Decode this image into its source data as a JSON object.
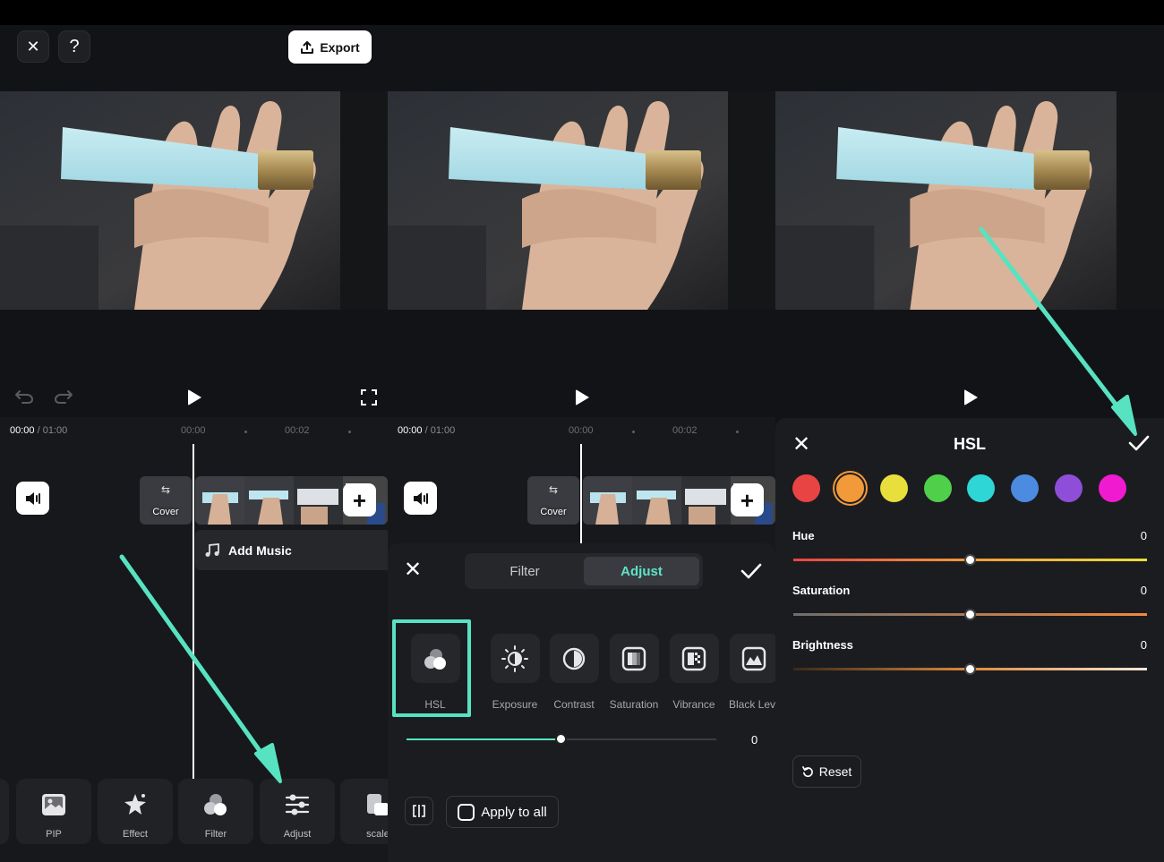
{
  "editor": {
    "export_label": "Export",
    "time_current": "00:00",
    "time_total": " / 01:00",
    "ruler_0": "00:00",
    "ruler_2": "00:02",
    "cover_label": "Cover",
    "add_music_label": "Add Music",
    "tools": [
      {
        "label": "PIP",
        "icon": "pip-icon"
      },
      {
        "label": "Effect",
        "icon": "effect-icon"
      },
      {
        "label": "Filter",
        "icon": "filter-icon"
      },
      {
        "label": "Adjust",
        "icon": "adjust-icon"
      },
      {
        "label": "scale",
        "icon": "scale-icon"
      }
    ]
  },
  "adjust_panel": {
    "tab_filter": "Filter",
    "tab_adjust": "Adjust",
    "tools": [
      {
        "label": "HSL",
        "icon": "hsl-icon"
      },
      {
        "label": "Exposure",
        "icon": "exposure-icon"
      },
      {
        "label": "Contrast",
        "icon": "contrast-icon"
      },
      {
        "label": "Saturation",
        "icon": "saturation-icon"
      },
      {
        "label": "Vibrance",
        "icon": "vibrance-icon"
      },
      {
        "label": "Black Level",
        "icon": "black-level-icon"
      }
    ],
    "slider_value": "0",
    "slider_fraction": 0.5,
    "apply_all_label": "Apply to all",
    "accent_color": "#57e3c1"
  },
  "hsl_panel": {
    "title": "HSL",
    "colors": [
      "#e84444",
      "#f29a3a",
      "#e9df3c",
      "#4fcf4a",
      "#2ed6d6",
      "#4c8be0",
      "#8e4ed8",
      "#f01ad0"
    ],
    "selected_color_index": 1,
    "sliders": [
      {
        "label": "Hue",
        "value": "0",
        "fraction": 0.5
      },
      {
        "label": "Saturation",
        "value": "0",
        "fraction": 0.5
      },
      {
        "label": "Brightness",
        "value": "0",
        "fraction": 0.5
      }
    ],
    "reset_label": "Reset"
  },
  "annotation_color": "#57e3c1"
}
